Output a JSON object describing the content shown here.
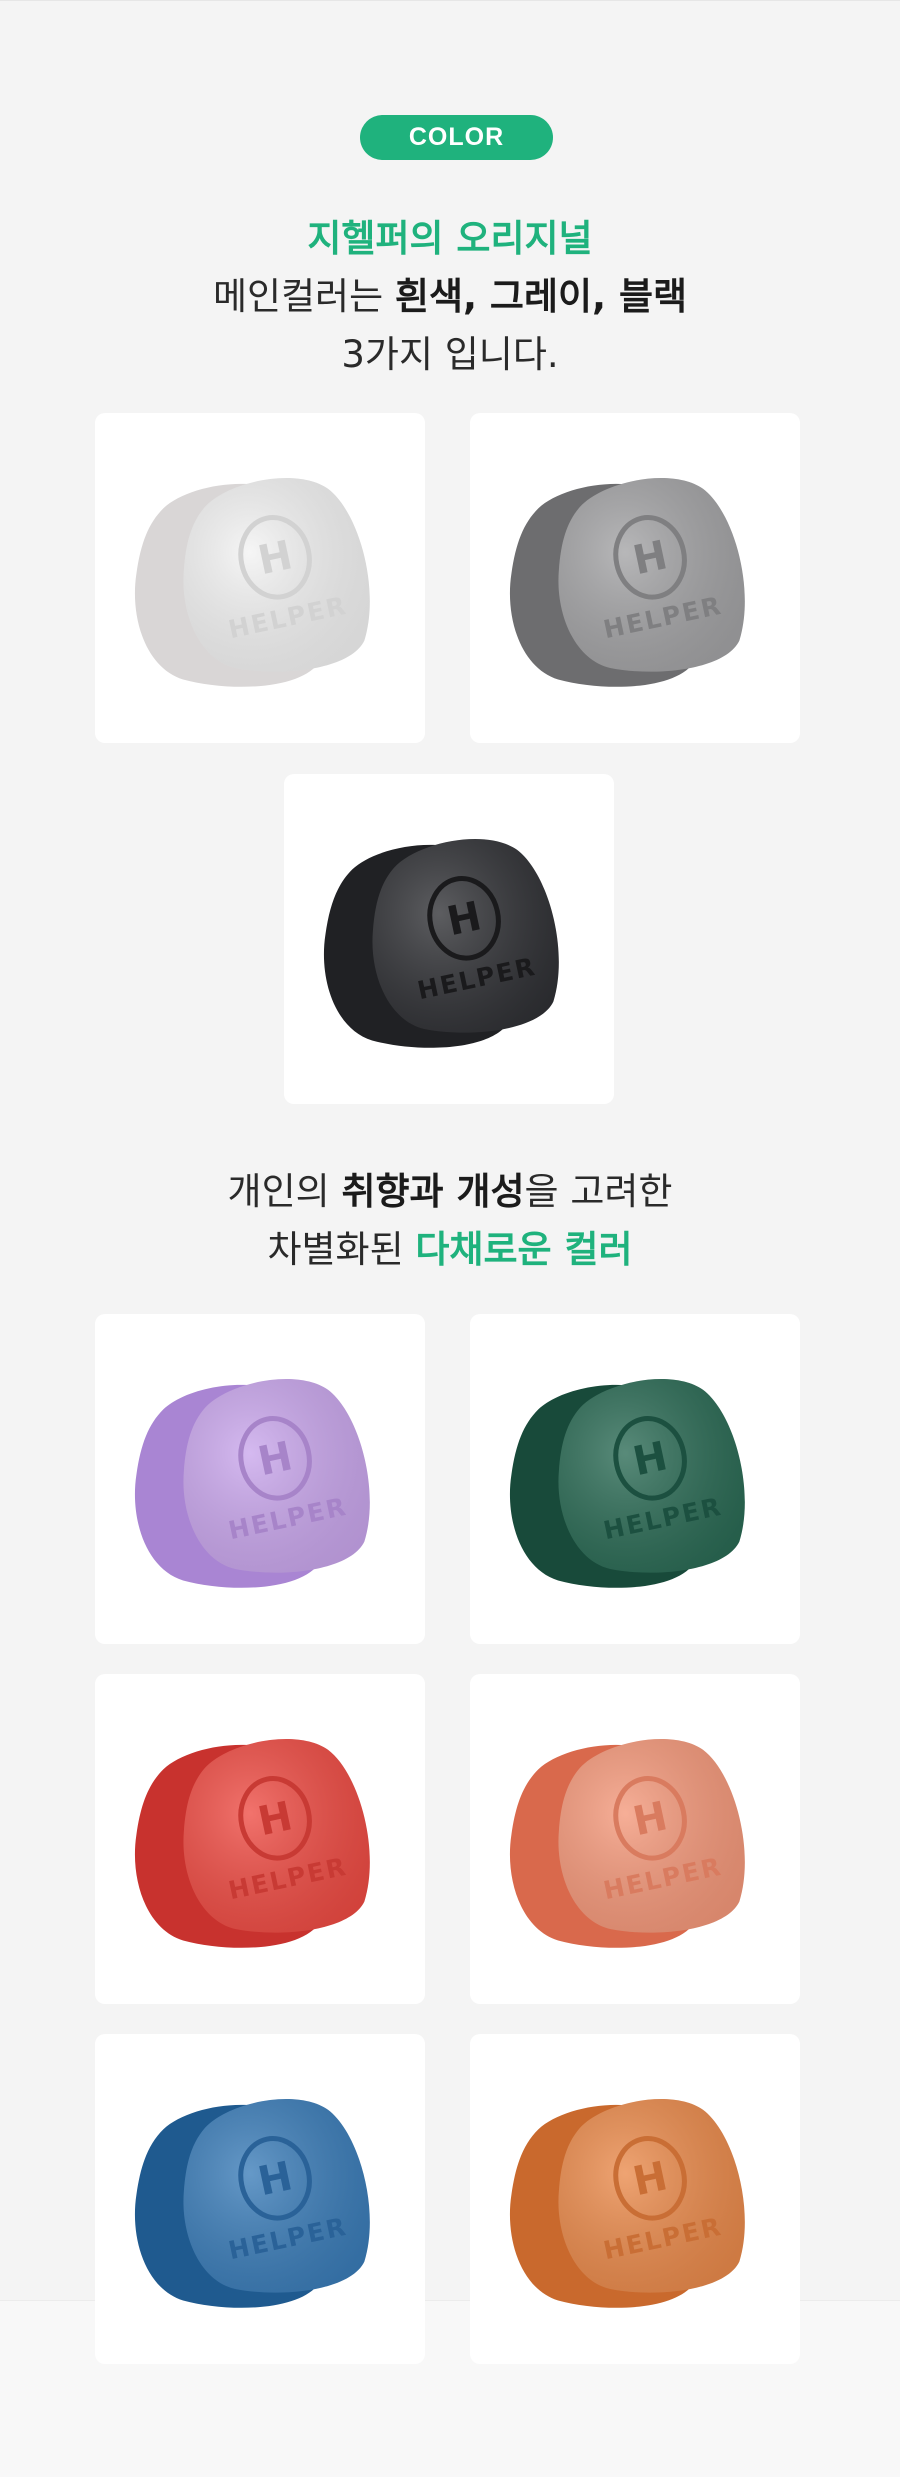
{
  "badge": {
    "label": "COLOR"
  },
  "intro": {
    "line1_green": "지헬퍼의 오리지널",
    "line2_prefix": "메인컬러는 ",
    "line2_bold": "흰색, 그레이, 블랙",
    "line3": "3가지 입니다."
  },
  "variety": {
    "line1_prefix": "개인의 ",
    "line1_bold1": "취향과 개성",
    "line1_mid": "을 고려한",
    "line2_prefix": "차별화된 ",
    "line2_green": "다채로운 컬러"
  },
  "product": {
    "logo_letter": "H",
    "logo_word": "HELPER"
  },
  "colors": {
    "accent": "#1fb27d",
    "main": [
      {
        "name": "white",
        "back": "#d9d6d6",
        "front": "#f3f3f3",
        "emboss": "#d2d2d2"
      },
      {
        "name": "gray",
        "back": "#6d6d6f",
        "front": "#a3a3a5",
        "emboss": "#7f7f81"
      },
      {
        "name": "black",
        "back": "#202124",
        "front": "#2f3034",
        "emboss": "#1a1a1c"
      }
    ],
    "variety": [
      {
        "name": "lavender",
        "back": "#a985d3",
        "front": "#c9a6ec",
        "emboss": "#a784c9"
      },
      {
        "name": "green",
        "back": "#184a3a",
        "front": "#2a6a54",
        "emboss": "#1c5040"
      },
      {
        "name": "red",
        "back": "#c8322e",
        "front": "#ee4b43",
        "emboss": "#c83a34"
      },
      {
        "name": "peach",
        "back": "#d9694c",
        "front": "#f4987a",
        "emboss": "#d97b5f"
      },
      {
        "name": "blue",
        "back": "#1f5a8f",
        "front": "#3a7cb8",
        "emboss": "#2a6298"
      },
      {
        "name": "orange",
        "back": "#c9692d",
        "front": "#ea8a4b",
        "emboss": "#c96e35"
      }
    ]
  }
}
